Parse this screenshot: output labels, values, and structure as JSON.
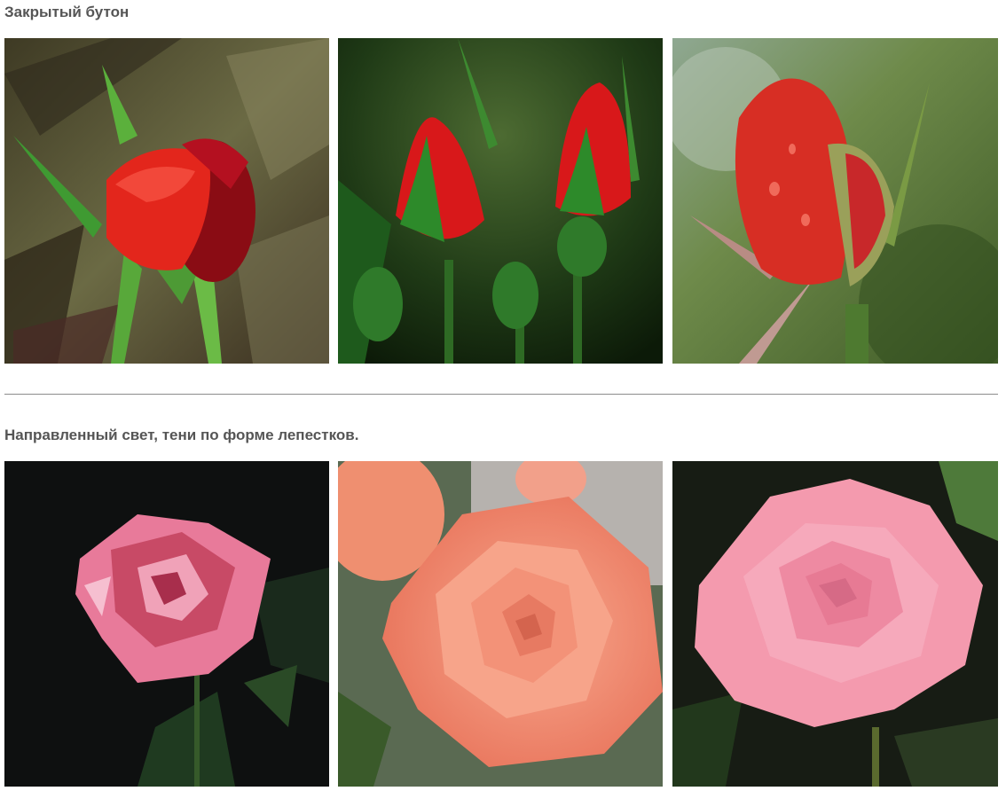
{
  "sections": [
    {
      "title": "Закрытый бутон",
      "images": [
        {
          "subject": "painted red rose bud on olive brushstroke background"
        },
        {
          "subject": "photo of red rose buds with green sepals on dark background"
        },
        {
          "subject": "photo of red rose bud with water drops on blurred green background"
        }
      ]
    },
    {
      "title": "Направленный свет, тени по форме лепестков.",
      "images": [
        {
          "subject": "painted pink rose on black background"
        },
        {
          "subject": "photo of open salmon-coral rose"
        },
        {
          "subject": "photo of open pink rose on dark foliage"
        }
      ]
    }
  ],
  "colors": {
    "heading_text": "#555555",
    "divider": "#8c8c8c",
    "bud_red": "#d8181a",
    "bud_dark_red": "#8a0c14",
    "coral": "#f49a7e",
    "pink": "#f49aae"
  }
}
